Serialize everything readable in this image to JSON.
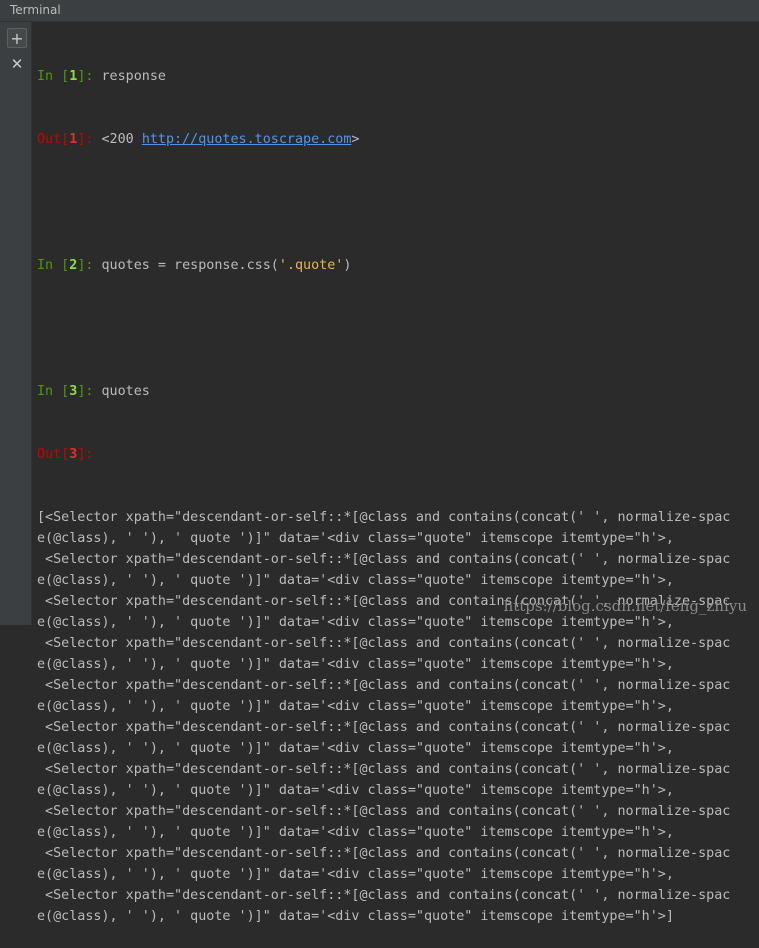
{
  "window": {
    "title": "Terminal"
  },
  "toolbar": {
    "add_glyph": "+",
    "close_glyph": "✕"
  },
  "cells": {
    "c1": {
      "in_prompt": "In [",
      "num": "1",
      "in_close": "]: ",
      "cmd": "response",
      "out_prompt": "Out[",
      "out_close": "]: ",
      "out_prefix": "<200 ",
      "link": "http://quotes.toscrape.com",
      "out_suffix": ">"
    },
    "c2": {
      "in_prompt": "In [",
      "num": "2",
      "in_close": "]: ",
      "cmd_prefix": "quotes = response.css(",
      "cmd_str": "'.quote'",
      "cmd_suffix": ")"
    },
    "c3": {
      "in_prompt": "In [",
      "num": "3",
      "in_close": "]: ",
      "cmd": "quotes",
      "out_prompt": "Out[",
      "out_close": "]: "
    }
  },
  "output": {
    "lines": [
      "[<Selector xpath=\"descendant-or-self::*[@class and contains(concat(' ', normalize-spac",
      "e(@class), ' '), ' quote ')]\" data='<div class=\"quote\" itemscope itemtype=\"h'>,",
      " <Selector xpath=\"descendant-or-self::*[@class and contains(concat(' ', normalize-spac",
      "e(@class), ' '), ' quote ')]\" data='<div class=\"quote\" itemscope itemtype=\"h'>,",
      " <Selector xpath=\"descendant-or-self::*[@class and contains(concat(' ', normalize-spac",
      "e(@class), ' '), ' quote ')]\" data='<div class=\"quote\" itemscope itemtype=\"h'>,",
      " <Selector xpath=\"descendant-or-self::*[@class and contains(concat(' ', normalize-spac",
      "e(@class), ' '), ' quote ')]\" data='<div class=\"quote\" itemscope itemtype=\"h'>,",
      " <Selector xpath=\"descendant-or-self::*[@class and contains(concat(' ', normalize-spac",
      "e(@class), ' '), ' quote ')]\" data='<div class=\"quote\" itemscope itemtype=\"h'>,",
      " <Selector xpath=\"descendant-or-self::*[@class and contains(concat(' ', normalize-spac",
      "e(@class), ' '), ' quote ')]\" data='<div class=\"quote\" itemscope itemtype=\"h'>,",
      " <Selector xpath=\"descendant-or-self::*[@class and contains(concat(' ', normalize-spac",
      "e(@class), ' '), ' quote ')]\" data='<div class=\"quote\" itemscope itemtype=\"h'>,",
      " <Selector xpath=\"descendant-or-self::*[@class and contains(concat(' ', normalize-spac",
      "e(@class), ' '), ' quote ')]\" data='<div class=\"quote\" itemscope itemtype=\"h'>,",
      " <Selector xpath=\"descendant-or-self::*[@class and contains(concat(' ', normalize-spac",
      "e(@class), ' '), ' quote ')]\" data='<div class=\"quote\" itemscope itemtype=\"h'>,",
      " <Selector xpath=\"descendant-or-self::*[@class and contains(concat(' ', normalize-spac",
      "e(@class), ' '), ' quote ')]\" data='<div class=\"quote\" itemscope itemtype=\"h'>]"
    ]
  },
  "watermark": "https://blog.csdn.net/feng_zhiyu",
  "colors": {
    "background": "#2b2b2b",
    "panel": "#3c3f41",
    "in_prompt": "#4e9a06",
    "out_prompt": "#cc0000",
    "link": "#5394ec",
    "string": "#e6b450",
    "text": "#bbbbbb"
  }
}
